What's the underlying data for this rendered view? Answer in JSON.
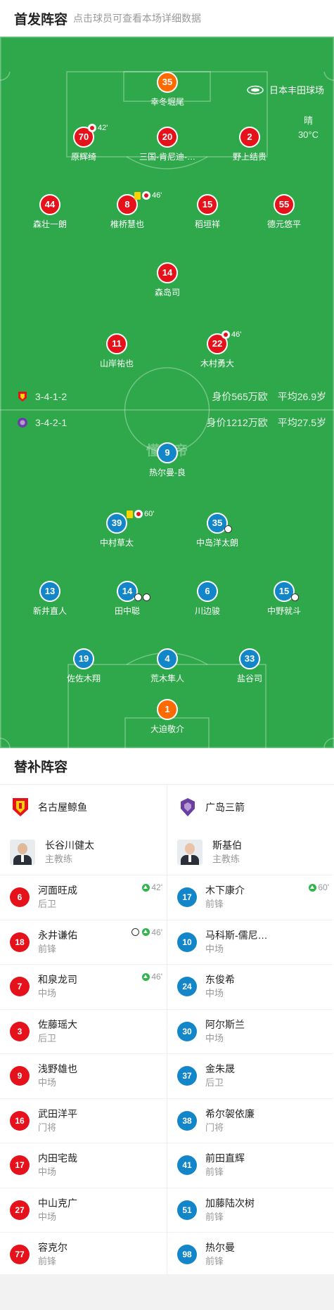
{
  "header": {
    "title": "首发阵容",
    "subtitle": "点击球员可查看本场详细数据"
  },
  "match": {
    "venue": "日本丰田球场",
    "weather": "晴",
    "temperature": "30°C",
    "watermark": "懂球帝"
  },
  "home": {
    "name": "名古屋鲸鱼",
    "formation": "3-4-1-2",
    "value": "身价565万欧",
    "age": "平均26.9岁",
    "color": "#e5121b",
    "players": [
      {
        "num": "35",
        "name": "幸冬堀尾",
        "kit": "orange"
      },
      {
        "num": "70",
        "name": "原辉绮",
        "kit": "red",
        "event": "42'"
      },
      {
        "num": "20",
        "name": "三国-肯尼迪-…",
        "kit": "red"
      },
      {
        "num": "2",
        "name": "野上结贵",
        "kit": "red"
      },
      {
        "num": "44",
        "name": "森壮一朗",
        "kit": "red"
      },
      {
        "num": "8",
        "name": "椎桥慧也",
        "kit": "red",
        "event": "46'"
      },
      {
        "num": "15",
        "name": "稻垣祥",
        "kit": "red"
      },
      {
        "num": "55",
        "name": "德元悠平",
        "kit": "red"
      },
      {
        "num": "14",
        "name": "森岛司",
        "kit": "red"
      },
      {
        "num": "11",
        "name": "山岸祐也",
        "kit": "red"
      },
      {
        "num": "22",
        "name": "木村勇大",
        "kit": "red",
        "event": "46'"
      }
    ]
  },
  "away": {
    "name": "广岛三箭",
    "formation": "3-4-2-1",
    "value": "身价1212万欧",
    "age": "平均27.5岁",
    "color": "#1386c9",
    "players": [
      {
        "num": "9",
        "name": "热尔曼-良",
        "kit": "blue"
      },
      {
        "num": "39",
        "name": "中村草太",
        "kit": "blue",
        "event": "60'"
      },
      {
        "num": "35",
        "name": "中岛洋太朗",
        "kit": "blue"
      },
      {
        "num": "13",
        "name": "新井直人",
        "kit": "blue"
      },
      {
        "num": "14",
        "name": "田中聪",
        "kit": "blue"
      },
      {
        "num": "6",
        "name": "川边骏",
        "kit": "blue"
      },
      {
        "num": "15",
        "name": "中野就斗",
        "kit": "blue"
      },
      {
        "num": "19",
        "name": "佐佐木翔",
        "kit": "blue"
      },
      {
        "num": "4",
        "name": "荒木隼人",
        "kit": "blue"
      },
      {
        "num": "33",
        "name": "盐谷司",
        "kit": "blue"
      },
      {
        "num": "1",
        "name": "大迫敬介",
        "kit": "orange"
      }
    ]
  },
  "subs": {
    "title": "替补阵容",
    "home_coach": {
      "name": "长谷川健太",
      "role": "主教练"
    },
    "away_coach": {
      "name": "斯基伯",
      "role": "主教练"
    },
    "home": [
      {
        "num": "6",
        "name": "河面旺成",
        "pos": "后卫",
        "time": "42'"
      },
      {
        "num": "18",
        "name": "永井谦佑",
        "pos": "前锋",
        "time": "46'"
      },
      {
        "num": "7",
        "name": "和泉龙司",
        "pos": "中场",
        "time": "46'"
      },
      {
        "num": "3",
        "name": "佐藤瑶大",
        "pos": "后卫"
      },
      {
        "num": "9",
        "name": "浅野雄也",
        "pos": "中场"
      },
      {
        "num": "16",
        "name": "武田洋平",
        "pos": "门将"
      },
      {
        "num": "17",
        "name": "内田宅哉",
        "pos": "中场"
      },
      {
        "num": "27",
        "name": "中山克广",
        "pos": "中场"
      },
      {
        "num": "77",
        "name": "容克尔",
        "pos": "前锋"
      }
    ],
    "away": [
      {
        "num": "17",
        "name": "木下康介",
        "pos": "前锋",
        "time": "60'"
      },
      {
        "num": "10",
        "name": "马科斯-儒尼…",
        "pos": "中场"
      },
      {
        "num": "24",
        "name": "东俊希",
        "pos": "中场"
      },
      {
        "num": "30",
        "name": "阿尔斯兰",
        "pos": "中场"
      },
      {
        "num": "37",
        "name": "金朱晟",
        "pos": "后卫"
      },
      {
        "num": "38",
        "name": "希尔袈依廉",
        "pos": "门将"
      },
      {
        "num": "41",
        "name": "前田直辉",
        "pos": "前锋"
      },
      {
        "num": "51",
        "name": "加藤陆次树",
        "pos": "前锋"
      },
      {
        "num": "98",
        "name": "热尔曼",
        "pos": "前锋"
      }
    ]
  }
}
